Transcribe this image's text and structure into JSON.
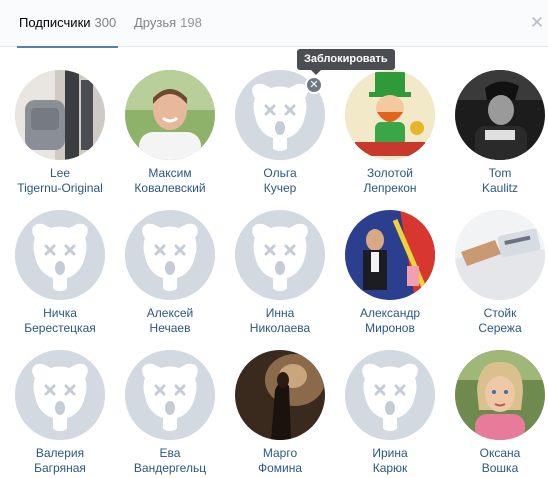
{
  "tabs": [
    {
      "label": "Подписчики",
      "count": "300"
    },
    {
      "label": "Друзья",
      "count": "198"
    }
  ],
  "close_icon": "close-icon",
  "tooltip": "Заблокировать",
  "block_icon": "cross-icon",
  "colors": {
    "link": "#2a5885",
    "tab_active_underline": "#5181b8",
    "tooltip_bg": "#4a4d52",
    "deactivated_avatar_bg": "#d8dde4"
  },
  "users": [
    {
      "first": "Lee",
      "last": "Tigernu-Original",
      "avatar": "photo-backpack"
    },
    {
      "first": "Максим",
      "last": "Ковалевский",
      "avatar": "photo-man"
    },
    {
      "first": "Ольга",
      "last": "Кучер",
      "avatar": "deactivated-dog-icon"
    },
    {
      "first": "Золотой",
      "last": "Лепрекон",
      "avatar": "photo-leprechaun"
    },
    {
      "first": "Tom",
      "last": "Kaulitz",
      "avatar": "photo-bw-portrait"
    },
    {
      "first": "Ничка",
      "last": "Берестецкая",
      "avatar": "deactivated-dog-icon"
    },
    {
      "first": "Алексей",
      "last": "Нечаев",
      "avatar": "deactivated-dog-icon"
    },
    {
      "first": "Инна",
      "last": "Николаева",
      "avatar": "deactivated-dog-icon"
    },
    {
      "first": "Александр",
      "last": "Миронов",
      "avatar": "photo-man-flag"
    },
    {
      "first": "Стойк",
      "last": "Сережа",
      "avatar": "photo-card"
    },
    {
      "first": "Валерия",
      "last": "Багряная",
      "avatar": "deactivated-dog-icon"
    },
    {
      "first": "Ева",
      "last": "Вандергельц",
      "avatar": "deactivated-dog-icon"
    },
    {
      "first": "Марго",
      "last": "Фомина",
      "avatar": "photo-dark-silhouette"
    },
    {
      "first": "Ирина",
      "last": "Карюк",
      "avatar": "deactivated-dog-icon"
    },
    {
      "first": "Оксана",
      "last": "Вошка",
      "avatar": "photo-woman"
    }
  ]
}
